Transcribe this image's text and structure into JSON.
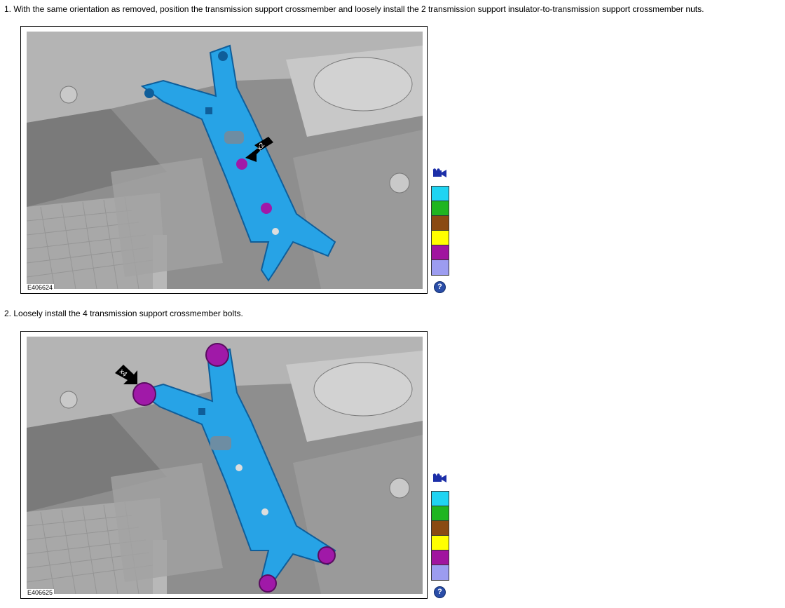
{
  "steps": [
    {
      "text": "1. With the same orientation as removed, position the transmission support crossmember and loosely install the 2 transmission support insulator-to-transmission support crossmember nuts.",
      "figure_id": "E406624",
      "callout": "x2"
    },
    {
      "text": "2. Loosely install the 4 transmission support crossmember bolts.",
      "figure_id": "E406625",
      "callout": "x4"
    }
  ],
  "legend": {
    "camera_icon": "video-camera-icon",
    "help_icon": "help-icon",
    "help_glyph": "?",
    "colors": [
      "#1fd4f2",
      "#1fb520",
      "#8a4a12",
      "#ffff00",
      "#a0149f",
      "#9c9cf0"
    ]
  },
  "palette": {
    "crossmember": "#27a3e6",
    "fastener": "#a019a8"
  }
}
